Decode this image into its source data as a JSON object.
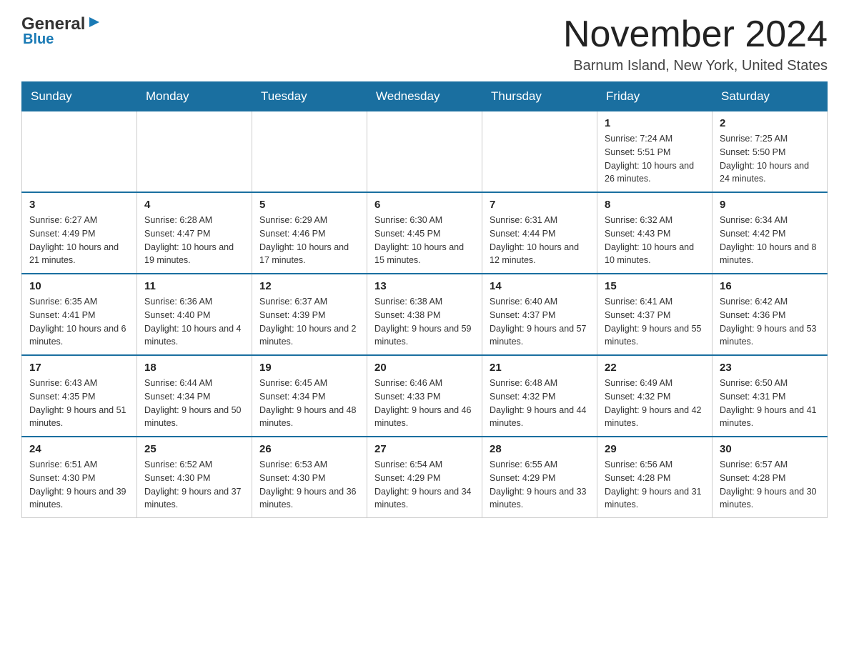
{
  "logo": {
    "general": "General",
    "blue": "Blue",
    "arrow": "▶"
  },
  "title": "November 2024",
  "location": "Barnum Island, New York, United States",
  "days_of_week": [
    "Sunday",
    "Monday",
    "Tuesday",
    "Wednesday",
    "Thursday",
    "Friday",
    "Saturday"
  ],
  "weeks": [
    [
      {
        "day": "",
        "info": ""
      },
      {
        "day": "",
        "info": ""
      },
      {
        "day": "",
        "info": ""
      },
      {
        "day": "",
        "info": ""
      },
      {
        "day": "",
        "info": ""
      },
      {
        "day": "1",
        "info": "Sunrise: 7:24 AM\nSunset: 5:51 PM\nDaylight: 10 hours and 26 minutes."
      },
      {
        "day": "2",
        "info": "Sunrise: 7:25 AM\nSunset: 5:50 PM\nDaylight: 10 hours and 24 minutes."
      }
    ],
    [
      {
        "day": "3",
        "info": "Sunrise: 6:27 AM\nSunset: 4:49 PM\nDaylight: 10 hours and 21 minutes."
      },
      {
        "day": "4",
        "info": "Sunrise: 6:28 AM\nSunset: 4:47 PM\nDaylight: 10 hours and 19 minutes."
      },
      {
        "day": "5",
        "info": "Sunrise: 6:29 AM\nSunset: 4:46 PM\nDaylight: 10 hours and 17 minutes."
      },
      {
        "day": "6",
        "info": "Sunrise: 6:30 AM\nSunset: 4:45 PM\nDaylight: 10 hours and 15 minutes."
      },
      {
        "day": "7",
        "info": "Sunrise: 6:31 AM\nSunset: 4:44 PM\nDaylight: 10 hours and 12 minutes."
      },
      {
        "day": "8",
        "info": "Sunrise: 6:32 AM\nSunset: 4:43 PM\nDaylight: 10 hours and 10 minutes."
      },
      {
        "day": "9",
        "info": "Sunrise: 6:34 AM\nSunset: 4:42 PM\nDaylight: 10 hours and 8 minutes."
      }
    ],
    [
      {
        "day": "10",
        "info": "Sunrise: 6:35 AM\nSunset: 4:41 PM\nDaylight: 10 hours and 6 minutes."
      },
      {
        "day": "11",
        "info": "Sunrise: 6:36 AM\nSunset: 4:40 PM\nDaylight: 10 hours and 4 minutes."
      },
      {
        "day": "12",
        "info": "Sunrise: 6:37 AM\nSunset: 4:39 PM\nDaylight: 10 hours and 2 minutes."
      },
      {
        "day": "13",
        "info": "Sunrise: 6:38 AM\nSunset: 4:38 PM\nDaylight: 9 hours and 59 minutes."
      },
      {
        "day": "14",
        "info": "Sunrise: 6:40 AM\nSunset: 4:37 PM\nDaylight: 9 hours and 57 minutes."
      },
      {
        "day": "15",
        "info": "Sunrise: 6:41 AM\nSunset: 4:37 PM\nDaylight: 9 hours and 55 minutes."
      },
      {
        "day": "16",
        "info": "Sunrise: 6:42 AM\nSunset: 4:36 PM\nDaylight: 9 hours and 53 minutes."
      }
    ],
    [
      {
        "day": "17",
        "info": "Sunrise: 6:43 AM\nSunset: 4:35 PM\nDaylight: 9 hours and 51 minutes."
      },
      {
        "day": "18",
        "info": "Sunrise: 6:44 AM\nSunset: 4:34 PM\nDaylight: 9 hours and 50 minutes."
      },
      {
        "day": "19",
        "info": "Sunrise: 6:45 AM\nSunset: 4:34 PM\nDaylight: 9 hours and 48 minutes."
      },
      {
        "day": "20",
        "info": "Sunrise: 6:46 AM\nSunset: 4:33 PM\nDaylight: 9 hours and 46 minutes."
      },
      {
        "day": "21",
        "info": "Sunrise: 6:48 AM\nSunset: 4:32 PM\nDaylight: 9 hours and 44 minutes."
      },
      {
        "day": "22",
        "info": "Sunrise: 6:49 AM\nSunset: 4:32 PM\nDaylight: 9 hours and 42 minutes."
      },
      {
        "day": "23",
        "info": "Sunrise: 6:50 AM\nSunset: 4:31 PM\nDaylight: 9 hours and 41 minutes."
      }
    ],
    [
      {
        "day": "24",
        "info": "Sunrise: 6:51 AM\nSunset: 4:30 PM\nDaylight: 9 hours and 39 minutes."
      },
      {
        "day": "25",
        "info": "Sunrise: 6:52 AM\nSunset: 4:30 PM\nDaylight: 9 hours and 37 minutes."
      },
      {
        "day": "26",
        "info": "Sunrise: 6:53 AM\nSunset: 4:30 PM\nDaylight: 9 hours and 36 minutes."
      },
      {
        "day": "27",
        "info": "Sunrise: 6:54 AM\nSunset: 4:29 PM\nDaylight: 9 hours and 34 minutes."
      },
      {
        "day": "28",
        "info": "Sunrise: 6:55 AM\nSunset: 4:29 PM\nDaylight: 9 hours and 33 minutes."
      },
      {
        "day": "29",
        "info": "Sunrise: 6:56 AM\nSunset: 4:28 PM\nDaylight: 9 hours and 31 minutes."
      },
      {
        "day": "30",
        "info": "Sunrise: 6:57 AM\nSunset: 4:28 PM\nDaylight: 9 hours and 30 minutes."
      }
    ]
  ]
}
